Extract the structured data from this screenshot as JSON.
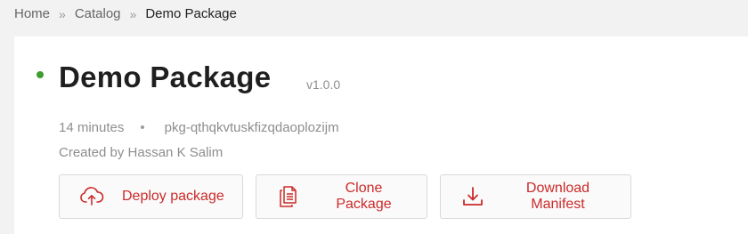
{
  "breadcrumb": {
    "items": [
      "Home",
      "Catalog",
      "Demo Package"
    ],
    "separator": "»"
  },
  "package": {
    "title": "Demo Package",
    "version": "v1.0.0",
    "age": "14 minutes",
    "meta_separator": "•",
    "id": "pkg-qthqkvtuskfizqdaoplozijm",
    "created_by": "Created by Hassan K Salim",
    "status_color": "#3f9d2f"
  },
  "actions": {
    "deploy_label": "Deploy package",
    "clone_label": "Clone Package",
    "download_label": "Download Manifest"
  },
  "colors": {
    "accent": "#cc2a2a",
    "background": "#f2f2f2",
    "card": "#ffffff"
  },
  "icons": {
    "deploy": "cloud-upload-icon",
    "clone": "copy-document-icon",
    "download": "download-icon"
  }
}
